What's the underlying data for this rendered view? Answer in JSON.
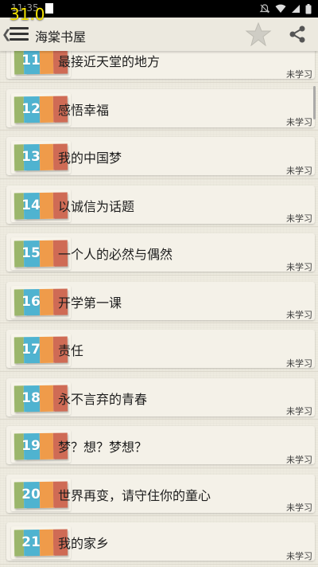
{
  "status_bar": {
    "time": "11:35",
    "icons": [
      "mute-icon",
      "wifi-icon",
      "signal-icon",
      "battery-icon"
    ]
  },
  "overlay": {
    "fps": "31.0"
  },
  "toolbar": {
    "title": "海棠书屋",
    "icons": [
      "menu-icon",
      "star-icon",
      "share-icon"
    ]
  },
  "items": [
    {
      "num": "11",
      "title": "最接近天堂的地方",
      "status": "未学习"
    },
    {
      "num": "12",
      "title": "感悟幸福",
      "status": "未学习"
    },
    {
      "num": "13",
      "title": "我的中国梦",
      "status": "未学习"
    },
    {
      "num": "14",
      "title": "以诚信为话题",
      "status": "未学习"
    },
    {
      "num": "15",
      "title": "一个人的必然与偶然",
      "status": "未学习"
    },
    {
      "num": "16",
      "title": "开学第一课",
      "status": "未学习"
    },
    {
      "num": "17",
      "title": "责任",
      "status": "未学习"
    },
    {
      "num": "18",
      "title": "永不言弃的青春",
      "status": "未学习"
    },
    {
      "num": "19",
      "title": "梦？想？梦想？",
      "status": "未学习"
    },
    {
      "num": "20",
      "title": "世界再变，请守住你的童心",
      "status": "未学习"
    },
    {
      "num": "21",
      "title": "我的家乡",
      "status": "未学习"
    }
  ],
  "colors": {
    "badge_green": "#9bb66b",
    "badge_blue": "#4fb3d0",
    "badge_orange": "#ef9b4a",
    "badge_red": "#cf6b55",
    "background": "#eeebe0"
  }
}
